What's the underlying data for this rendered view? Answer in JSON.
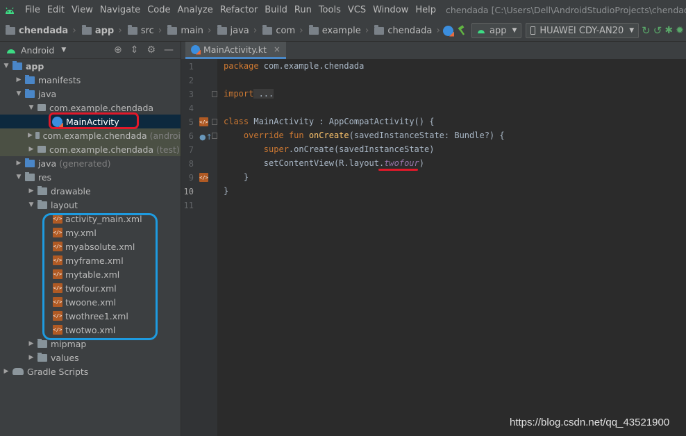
{
  "menubar": {
    "items": [
      "File",
      "Edit",
      "View",
      "Navigate",
      "Code",
      "Analyze",
      "Refactor",
      "Build",
      "Run",
      "Tools",
      "VCS",
      "Window",
      "Help"
    ],
    "window_title": "chendada [C:\\Users\\Dell\\AndroidStudioProjects\\chendada] - ..."
  },
  "navbar": {
    "crumbs": [
      "chendada",
      "app",
      "src",
      "main",
      "java",
      "com",
      "example",
      "chendada"
    ],
    "run_config": "app",
    "device": "HUAWEI CDY-AN20"
  },
  "project": {
    "view_mode": "Android",
    "tree": [
      {
        "label": "app"
      },
      {
        "label": "manifests"
      },
      {
        "label": "java"
      },
      {
        "label": "com.example.chendada"
      },
      {
        "label": "MainActivity"
      },
      {
        "label": "com.example.chendada",
        "note": "(androi"
      },
      {
        "label": "com.example.chendada",
        "note": "(test)"
      },
      {
        "label": "java",
        "note": "(generated)"
      },
      {
        "label": "res"
      },
      {
        "label": "drawable"
      },
      {
        "label": "layout"
      },
      {
        "label": "activity_main.xml"
      },
      {
        "label": "my.xml"
      },
      {
        "label": "myabsolute.xml"
      },
      {
        "label": "myframe.xml"
      },
      {
        "label": "mytable.xml"
      },
      {
        "label": "twofour.xml"
      },
      {
        "label": "twoone.xml"
      },
      {
        "label": "twothree1.xml"
      },
      {
        "label": "twotwo.xml"
      },
      {
        "label": "mipmap"
      },
      {
        "label": "values"
      },
      {
        "label": "Gradle Scripts"
      }
    ]
  },
  "editor": {
    "tab": "MainActivity.kt",
    "line_numbers": [
      "1",
      "2",
      "3",
      "4",
      "5",
      "6",
      "7",
      "8",
      "9",
      "10",
      "11"
    ],
    "code": {
      "l1_kw": "package",
      "l1_rest": " com.example.chendada",
      "l3_kw": "import",
      "l3_rest": " ...",
      "l6_kw": "class",
      "l6_rest": " MainActivity : AppCompatActivity() {",
      "l7_kw": "    override fun",
      "l7_fn": " onCreate",
      "l7_rest": "(savedInstanceState: Bundle?) {",
      "l8_kw": "        super",
      "l8_rest": ".onCreate(savedInstanceState)",
      "l9_rest": "        setContentView(R.layout.",
      "l9_ref": "twofour",
      "l9_end": ")",
      "l10": "    }",
      "l11": "}"
    }
  },
  "watermark": "https://blog.csdn.net/qq_43521900"
}
